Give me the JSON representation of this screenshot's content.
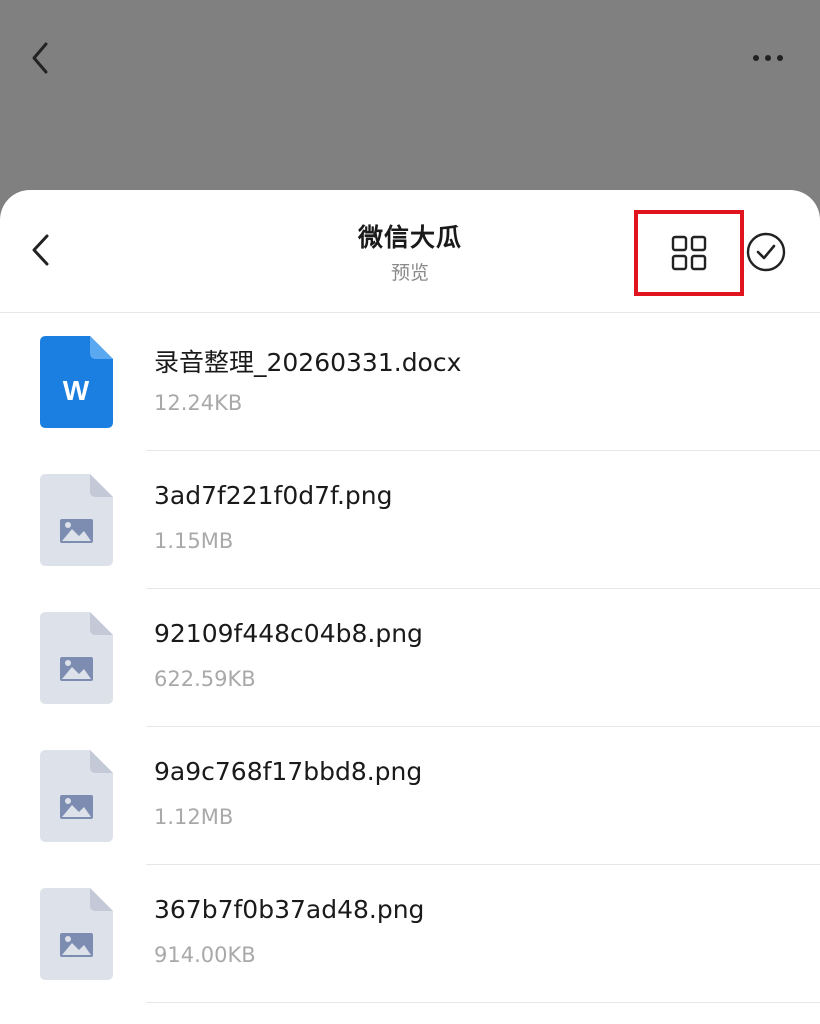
{
  "background_screen": {
    "back_icon": "chevron-left-icon",
    "more_icon": "more-horizontal-icon"
  },
  "sheet": {
    "title": "微信大瓜",
    "subtitle": "预览",
    "back_icon": "chevron-left-icon",
    "grid_view_icon": "grid-view-icon",
    "select_icon": "check-circle-icon",
    "highlight_color": "#e0141e"
  },
  "files": [
    {
      "name": "录音整理_20260331.docx",
      "size": "12.24KB",
      "type": "word",
      "icon_letter": "W"
    },
    {
      "name": "3ad7f221f0d7f.png",
      "size": "1.15MB",
      "type": "image"
    },
    {
      "name": "92109f448c04b8.png",
      "size": "622.59KB",
      "type": "image"
    },
    {
      "name": "9a9c768f17bbd8.png",
      "size": "1.12MB",
      "type": "image"
    },
    {
      "name": "367b7f0b37ad48.png",
      "size": "914.00KB",
      "type": "image"
    }
  ],
  "colors": {
    "word_icon": "#1a7fe0",
    "image_icon_bg": "#dde1e9",
    "image_icon_glyph": "#7d8db2"
  }
}
